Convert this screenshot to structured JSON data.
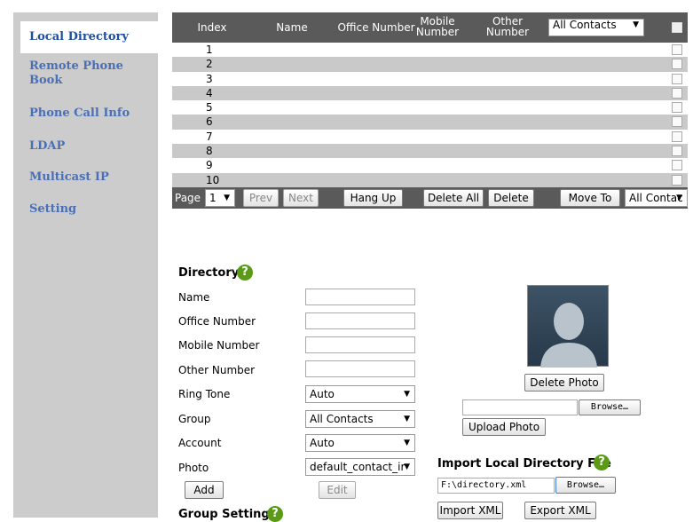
{
  "sidebar": {
    "items": [
      {
        "label": "Local Directory"
      },
      {
        "label": "Remote Phone Book"
      },
      {
        "label": "Phone Call Info"
      },
      {
        "label": "LDAP"
      },
      {
        "label": "Multicast IP"
      },
      {
        "label": "Setting"
      }
    ]
  },
  "table": {
    "headers": {
      "index": "Index",
      "name": "Name",
      "office": "Office Number",
      "mobile": "Mobile Number",
      "other": "Other Number"
    },
    "filter": "All Contacts",
    "rows": [
      "1",
      "2",
      "3",
      "4",
      "5",
      "6",
      "7",
      "8",
      "9",
      "10"
    ]
  },
  "pager": {
    "page_label": "Page",
    "page_value": "1",
    "prev": "Prev",
    "next": "Next",
    "hang_up": "Hang Up",
    "delete_all": "Delete All",
    "delete": "Delete",
    "move_to": "Move To",
    "move_target": "All Contac"
  },
  "directory": {
    "title": "Directory",
    "fields": {
      "name": "Name",
      "office": "Office Number",
      "mobile": "Mobile Number",
      "other": "Other Number",
      "ring_tone": "Ring Tone",
      "group": "Group",
      "account": "Account",
      "photo": "Photo"
    },
    "values": {
      "ring_tone": "Auto",
      "group": "All Contacts",
      "account": "Auto",
      "photo": "default_contact_ir"
    },
    "add": "Add",
    "edit": "Edit"
  },
  "photo_panel": {
    "delete_photo": "Delete Photo",
    "browse": "Browse…",
    "upload_photo": "Upload Photo"
  },
  "import": {
    "title": "Import Local Directory File",
    "file_value": "F:\\directory.xml",
    "browse": "Browse…",
    "import_xml": "Import XML",
    "export_xml": "Export XML"
  },
  "group_setting": {
    "title": "Group Setting"
  }
}
